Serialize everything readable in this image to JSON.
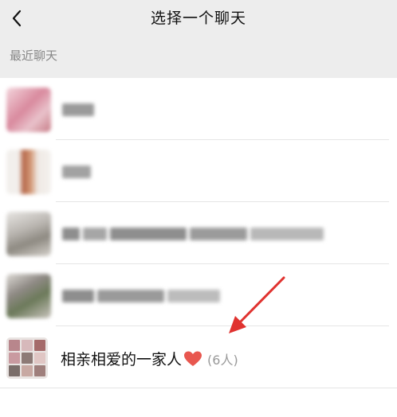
{
  "nav": {
    "title": "选择一个聊天",
    "back_icon": "chevron-left-icon"
  },
  "section": {
    "label": "最近聊天"
  },
  "chats": [
    {
      "name": "",
      "blurred": true
    },
    {
      "name": "",
      "blurred": true
    },
    {
      "name": "",
      "blurred": true
    },
    {
      "name": "",
      "blurred": true
    },
    {
      "name": "相亲相爱的一家人",
      "emoji": "❤️",
      "member_count": "(6人)",
      "blurred": false
    }
  ],
  "annotation": {
    "arrow_color": "#e0322f",
    "arrow_icon": "red-arrow-icon"
  }
}
